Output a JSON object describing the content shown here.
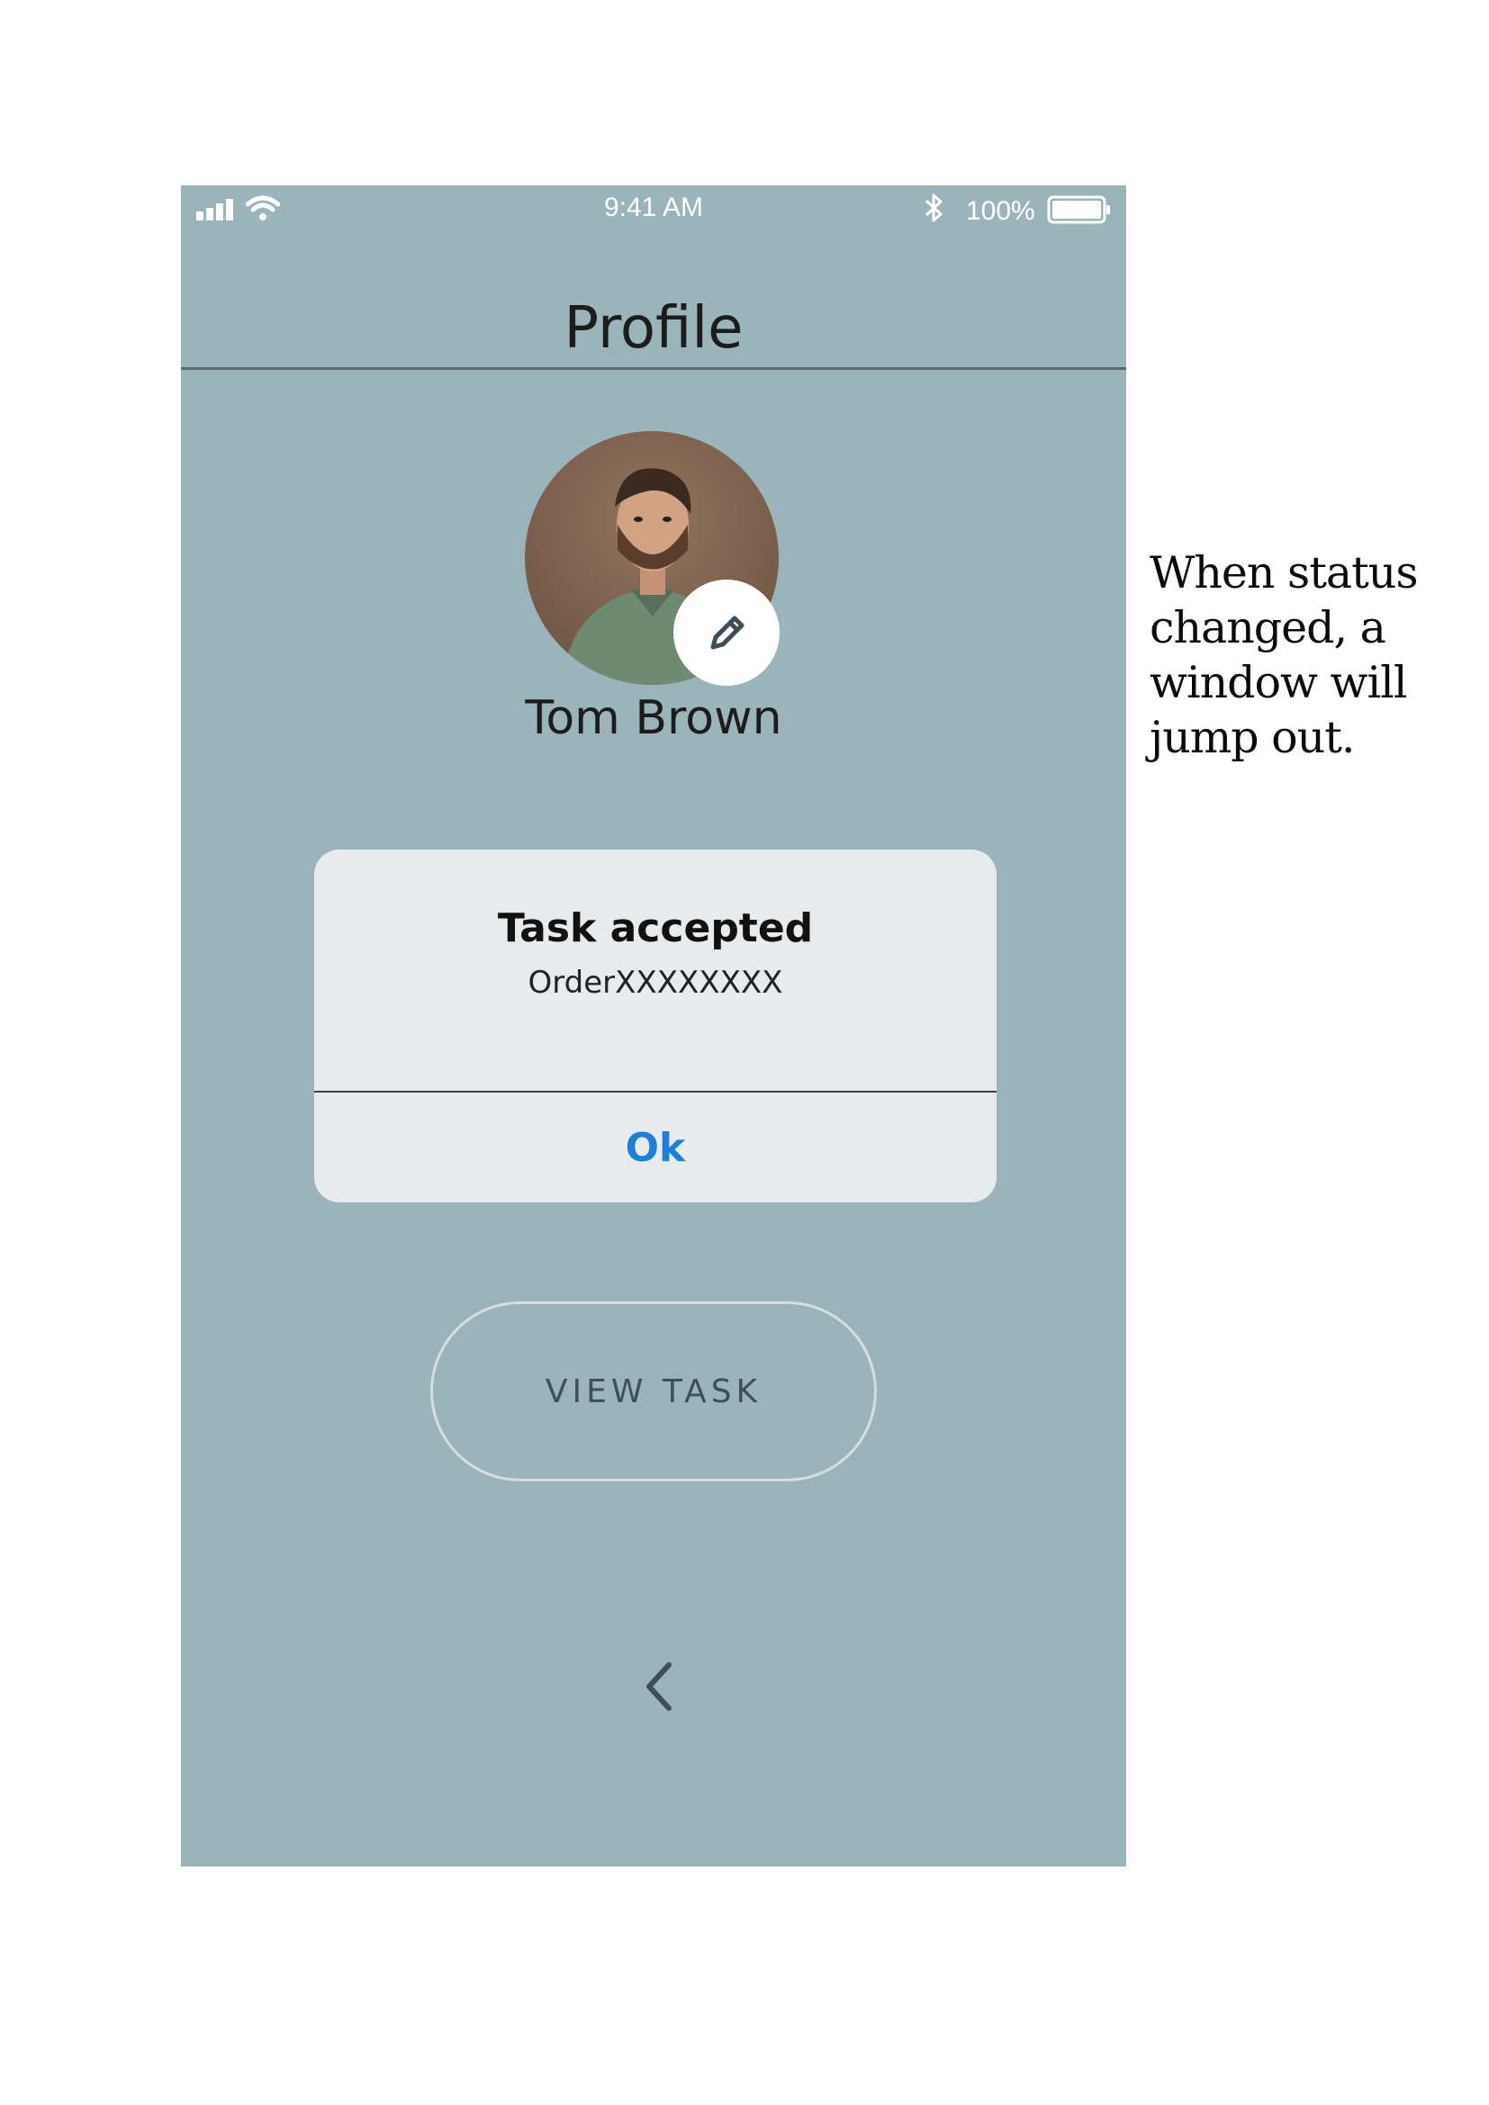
{
  "status_bar": {
    "time": "9:41 AM",
    "battery_percent": "100%",
    "icons": [
      "cellular-signal-icon",
      "wifi-icon",
      "bluetooth-icon",
      "battery-icon"
    ]
  },
  "header": {
    "title": "Profile"
  },
  "profile": {
    "name": "Tom Brown",
    "avatar": "user-photo",
    "edit_icon": "pencil-icon"
  },
  "dialog": {
    "title": "Task accepted",
    "message": "OrderXXXXXXXX",
    "ok_label": "Ok"
  },
  "actions": {
    "view_task_label": "VIEW TASK",
    "back_icon": "chevron-left-icon"
  },
  "annotation": {
    "text": "When status changed, a window will jump out."
  },
  "colors": {
    "screen_background": "#9ab4ba",
    "dialog_background": "#e7ebed",
    "dialog_ok": "#1e7fd8",
    "title_text": "#1c1c1c"
  }
}
